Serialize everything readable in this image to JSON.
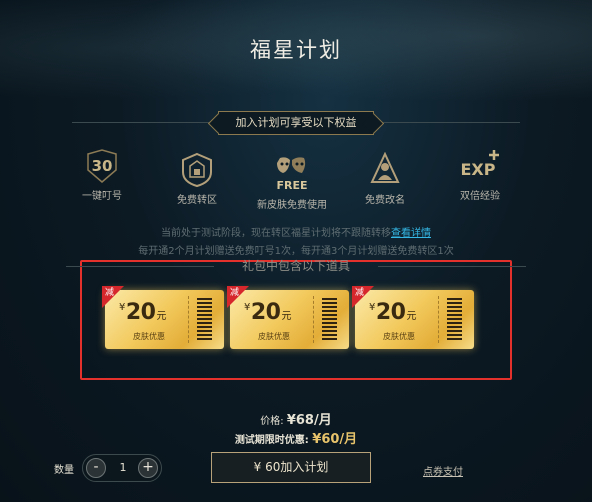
{
  "page": {
    "title": "福星计划"
  },
  "benefits": {
    "banner": "加入计划可享受以下权益",
    "perks": [
      {
        "icon": "thirty-badge-icon",
        "icon_text": "30",
        "label": "一键叮号"
      },
      {
        "icon": "shield-transfer-icon",
        "icon_text": "",
        "label": "免费转区"
      },
      {
        "icon": "free-mask-icon",
        "icon_text": "FREE",
        "label": "新皮肤免费使用"
      },
      {
        "icon": "rename-figure-icon",
        "icon_text": "",
        "label": "免费改名"
      },
      {
        "icon": "exp-plus-icon",
        "icon_text": "EXP",
        "label": "双倍经验"
      }
    ]
  },
  "notice": {
    "line1": "当前处于测试阶段，现在转区福星计划将不跟随转移",
    "link": "查看详情",
    "line2": "每开通2个月计划赠送免费叮号1次，每开通3个月计划赠送免费转区1次"
  },
  "items": {
    "title": "礼包中包含以下道具",
    "coupons": [
      {
        "tag": "减",
        "yen": "¥",
        "amount": "20",
        "unit": "元",
        "sub": "皮肤优惠"
      },
      {
        "tag": "减",
        "yen": "¥",
        "amount": "20",
        "unit": "元",
        "sub": "皮肤优惠"
      },
      {
        "tag": "减",
        "yen": "¥",
        "amount": "20",
        "unit": "元",
        "sub": "皮肤优惠"
      }
    ]
  },
  "pricing": {
    "price_label": "价格:",
    "price_value": "¥68/月",
    "trial_label": "测试期限时优惠:",
    "trial_value": "¥60/月"
  },
  "purchase": {
    "qty_label": "数量",
    "minus": "-",
    "qty_value": "1",
    "plus": "+",
    "join_label": "¥ 60加入计划",
    "points_link": "点券支付"
  },
  "colors": {
    "accent_gold": "#b8a27a",
    "trial_price": "#e7c36b",
    "link": "#35b8e6",
    "highlight_frame": "#e5312c"
  }
}
